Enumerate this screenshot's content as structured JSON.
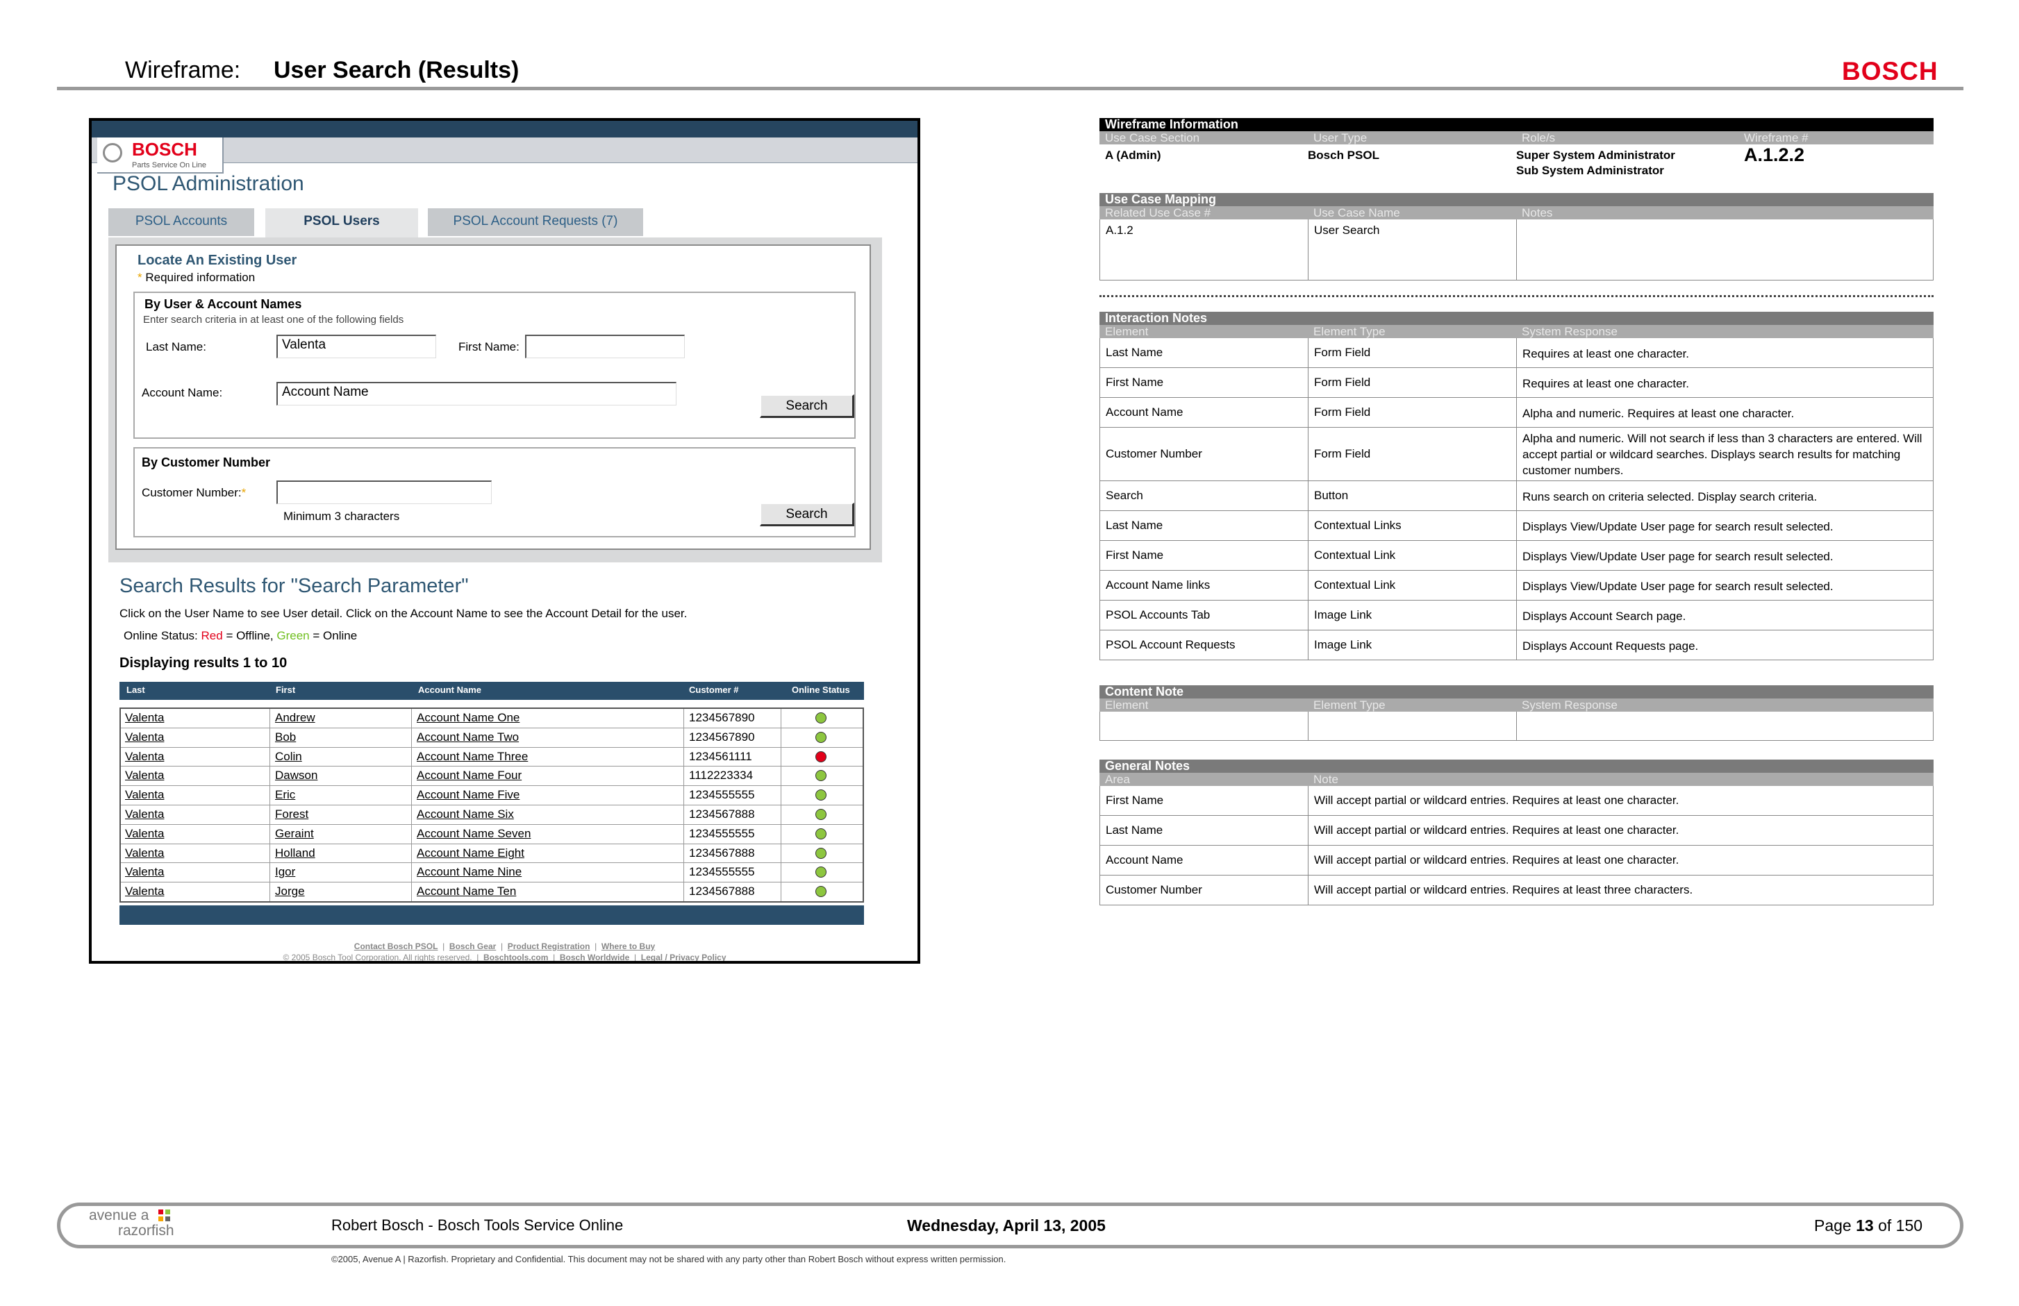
{
  "header": {
    "prefix": "Wireframe:",
    "title": "User Search (Results)",
    "logo": "BOSCH"
  },
  "mock": {
    "logo_word": "BOSCH",
    "logo_tagline": "Parts Service On Line",
    "app_title": "PSOL Administration",
    "tabs": [
      {
        "label": "PSOL Accounts",
        "active": false
      },
      {
        "label": "PSOL Users",
        "active": true
      },
      {
        "label": "PSOL Account Requests  (7)",
        "active": false
      }
    ],
    "locate_title": "Locate An Existing User",
    "required_mark": "*",
    "required_text": "Required information",
    "by_names_title": "By User & Account Names",
    "by_names_hint": "Enter search criteria in at least one of the following fields",
    "last_name_label": "Last Name:",
    "last_name_value": "Valenta",
    "first_name_label": "First Name:",
    "first_name_value": "",
    "account_name_label": "Account Name:",
    "account_name_value": "Account Name",
    "search_label": "Search",
    "by_customer_title": "By Customer Number",
    "customer_label": "Customer Number:",
    "customer_value": "",
    "customer_hint": "Minimum 3 characters",
    "results_title": "Search Results for \"Search Parameter\"",
    "results_instructions": "Click on the User Name to see User detail. Click on the Account Name to see the Account Detail for the user.",
    "status_prefix": "Online Status:",
    "status_red": "Red",
    "status_red_desc": "= Offline,",
    "status_green": "Green",
    "status_green_desc": "= Online",
    "displaying": "Displaying results 1 to 10",
    "columns": [
      "Last",
      "First",
      "Account Name",
      "Customer #",
      "Online Status"
    ],
    "rows": [
      {
        "last": "Valenta",
        "first": "Andrew",
        "account": "Account Name One",
        "customer": "1234567890",
        "status": "green"
      },
      {
        "last": "Valenta",
        "first": "Bob",
        "account": "Account Name Two",
        "customer": "1234567890",
        "status": "green"
      },
      {
        "last": "Valenta",
        "first": "Colin",
        "account": "Account Name Three",
        "customer": "1234561111",
        "status": "red"
      },
      {
        "last": "Valenta",
        "first": "Dawson",
        "account": "Account Name Four",
        "customer": "1112223334",
        "status": "green"
      },
      {
        "last": "Valenta",
        "first": "Eric",
        "account": "Account Name Five",
        "customer": "1234555555",
        "status": "green"
      },
      {
        "last": "Valenta",
        "first": "Forest",
        "account": "Account Name Six",
        "customer": "1234567888",
        "status": "green"
      },
      {
        "last": "Valenta",
        "first": "Geraint",
        "account": "Account Name Seven",
        "customer": "1234555555",
        "status": "green"
      },
      {
        "last": "Valenta",
        "first": "Holland",
        "account": "Account Name Eight",
        "customer": "1234567888",
        "status": "green"
      },
      {
        "last": "Valenta",
        "first": "Igor",
        "account": "Account Name Nine",
        "customer": "1234555555",
        "status": "green"
      },
      {
        "last": "Valenta",
        "first": "Jorge",
        "account": "Account Name Ten",
        "customer": "1234567888",
        "status": "green"
      }
    ],
    "status_colors": {
      "green": "#8dc63f",
      "red": "#e2001a"
    },
    "footer_links1": [
      "Contact Bosch PSOL",
      "Bosch Gear",
      "Product Registration",
      "Where to Buy"
    ],
    "footer_copy": "© 2005 Bosch Tool Corporation. All rights reserved.",
    "footer_links2": [
      "Boschtools.com",
      "Bosch Worldwide",
      "Legal / Privacy Policy"
    ]
  },
  "wireframe_info": {
    "title": "Wireframe Information",
    "headers": [
      "Use Case Section",
      "User Type",
      "Role/s",
      "Wireframe #"
    ],
    "section": "A (Admin)",
    "user_type": "Bosch PSOL",
    "role1": "Super System Administrator",
    "role2": "Sub System Administrator",
    "number": "A.1.2.2"
  },
  "use_case_mapping": {
    "title": "Use Case Mapping",
    "headers": [
      "Related Use Case #",
      "Use Case Name",
      "Notes"
    ],
    "case_no": "A.1.2",
    "case_name": "User Search",
    "notes": ""
  },
  "interaction_notes": {
    "title": "Interaction Notes",
    "headers": [
      "Element",
      "Element Type",
      "System Response"
    ],
    "rows": [
      {
        "element": "Last Name",
        "type": "Form Field",
        "response": "Requires at least one character."
      },
      {
        "element": "First Name",
        "type": "Form Field",
        "response": "Requires at least one character."
      },
      {
        "element": "Account Name",
        "type": "Form Field",
        "response": "Alpha and numeric. Requires at least one character."
      },
      {
        "element": "Customer Number",
        "type": "Form Field",
        "response": "Alpha and numeric.  Will not search if less than 3 characters are entered. Will accept partial or wildcard searches. Displays search results for matching customer numbers."
      },
      {
        "element": "Search",
        "type": "Button",
        "response": "Runs search on criteria selected. Display search criteria."
      },
      {
        "element": "Last Name",
        "type": "Contextual Links",
        "response": "Displays View/Update User page for search result selected."
      },
      {
        "element": "First Name",
        "type": "Contextual Link",
        "response": "Displays View/Update User page for search result selected."
      },
      {
        "element": "Account Name links",
        "type": "Contextual Link",
        "response": "Displays View/Update User page for search result selected."
      },
      {
        "element": "PSOL Accounts Tab",
        "type": "Image Link",
        "response": "Displays Account Search page."
      },
      {
        "element": "PSOL Account Requests",
        "type": "Image Link",
        "response": "Displays Account Requests page."
      }
    ]
  },
  "content_note": {
    "title": "Content Note",
    "headers": [
      "Element",
      "Element Type",
      "System Response"
    ]
  },
  "general_notes": {
    "title": "General Notes",
    "headers": [
      "Area",
      "Note"
    ],
    "rows": [
      {
        "area": "First Name",
        "note": "Will accept partial or wildcard entries. Requires at least one character."
      },
      {
        "area": "Last Name",
        "note": "Will accept partial or wildcard entries. Requires at least one character."
      },
      {
        "area": "Account Name",
        "note": "Will accept partial or wildcard entries. Requires at least one character."
      },
      {
        "area": "Customer Number",
        "note": "Will accept partial or wildcard entries. Requires at least three characters."
      }
    ]
  },
  "footer": {
    "agency_line1": "avenue a",
    "agency_line2": "razorfish",
    "client": "Robert Bosch - Bosch Tools Service Online",
    "date": "Wednesday, April 13, 2005",
    "page_prefix": "Page",
    "page_number": "13",
    "page_of": "of 150",
    "copyright": "©2005, Avenue A | Razorfish.   Proprietary and Confidential.  This document may not be shared with any party other than Robert Bosch without express written permission."
  }
}
